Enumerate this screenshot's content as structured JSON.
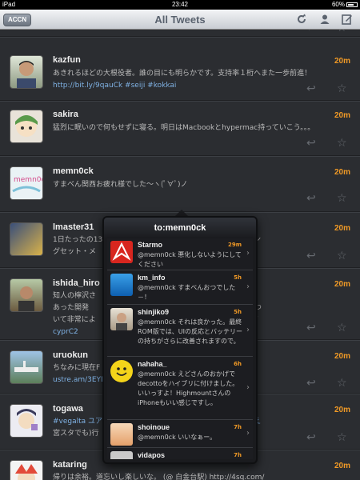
{
  "status_bar": {
    "device": "iPad",
    "time": "23:42",
    "battery": "60%"
  },
  "nav": {
    "account_button": "ACCN",
    "title": "All Tweets"
  },
  "tweets": [
    {
      "name": "kazfun",
      "time": "20m",
      "text": "あきれるほどの大根役者。誰の目にも明らかです。支持率１桁へまた一歩前進！",
      "link": "http://bit.ly/9qauCk #seiji #kokkai"
    },
    {
      "name": "sakira",
      "time": "20m",
      "text": "猛烈に眠いので何もせずに寝る。明日はMacbookとhypermac持っていこう。。。",
      "link": ""
    },
    {
      "name": "memn0ck",
      "time": "20m",
      "text": "すまべん関西お疲れ様でした〜ヽ(ﾟ∀ﾟ)ノ",
      "link": ""
    },
    {
      "name": "lmaster31",
      "time": "20m",
      "text": "1日たったの13　　　　　　　　　　　　　　　　　　　ーニン",
      "text2": "グセット・メ",
      "link": ""
    },
    {
      "name": "ishida_hiro",
      "time": "20m",
      "text": "知人の檸沢さ　　　　　　　　　　　　　　　　　　　興味が",
      "text2": "あった開発　　　　　　　　　　　　　　　　　　　　ブ」につ",
      "text3": "いて非常によ　　　　　　　　　　　　　　　　　　　//bit.ly/",
      "link": "cyprC2"
    },
    {
      "name": "uruokun",
      "time": "20m",
      "text": "ちなみに現在F",
      "link": "ustre.am/3EYD"
    },
    {
      "name": "togawa",
      "time": "20m",
      "text": "#vegalta ユア　　　　　　　　　　　　　　　　　　　たとえ",
      "text2": "宮スタでも)行",
      "link": ""
    },
    {
      "name": "kataring",
      "time": "20m",
      "text": "帰りは余裕。道忘いし楽しいな。 (@ 白金台駅) http://4sq.com/",
      "link": ""
    }
  ],
  "popover": {
    "title": "to:memn0ck",
    "items": [
      {
        "name": "Starmo",
        "time": "29m",
        "text": "@memn0ck 悪化しないようにしてください"
      },
      {
        "name": "km_info",
        "time": "5h",
        "text": "@memn0ck すまべんおつでした－！"
      },
      {
        "name": "shinjiko9",
        "time": "5h",
        "text": "@memn0ck それは良かった。最終ROM版では、UIの反応とバッテリーの持ちがさらに改善されますので。"
      },
      {
        "name": "nahaha_",
        "time": "6h",
        "text": "@memn0ck えどさんのおかげでdecottoをハイブリに付けました。いいっすよ！Highmountさんの iPhoneもいい感じですし。"
      },
      {
        "name": "shoinoue",
        "time": "7h",
        "text": "@memn0ck いいなぁー。"
      },
      {
        "name": "vidapos",
        "time": "7h",
        "text": ""
      }
    ]
  },
  "icons": {
    "refresh": "refresh-icon",
    "profile": "person-icon",
    "compose": "compose-icon",
    "reply": "reply-icon",
    "star": "star-icon",
    "chevron": "chevron-right-icon"
  },
  "colors": {
    "time_accent": "#f19a26",
    "link": "#7fb1e3",
    "background": "#2b2d31"
  }
}
